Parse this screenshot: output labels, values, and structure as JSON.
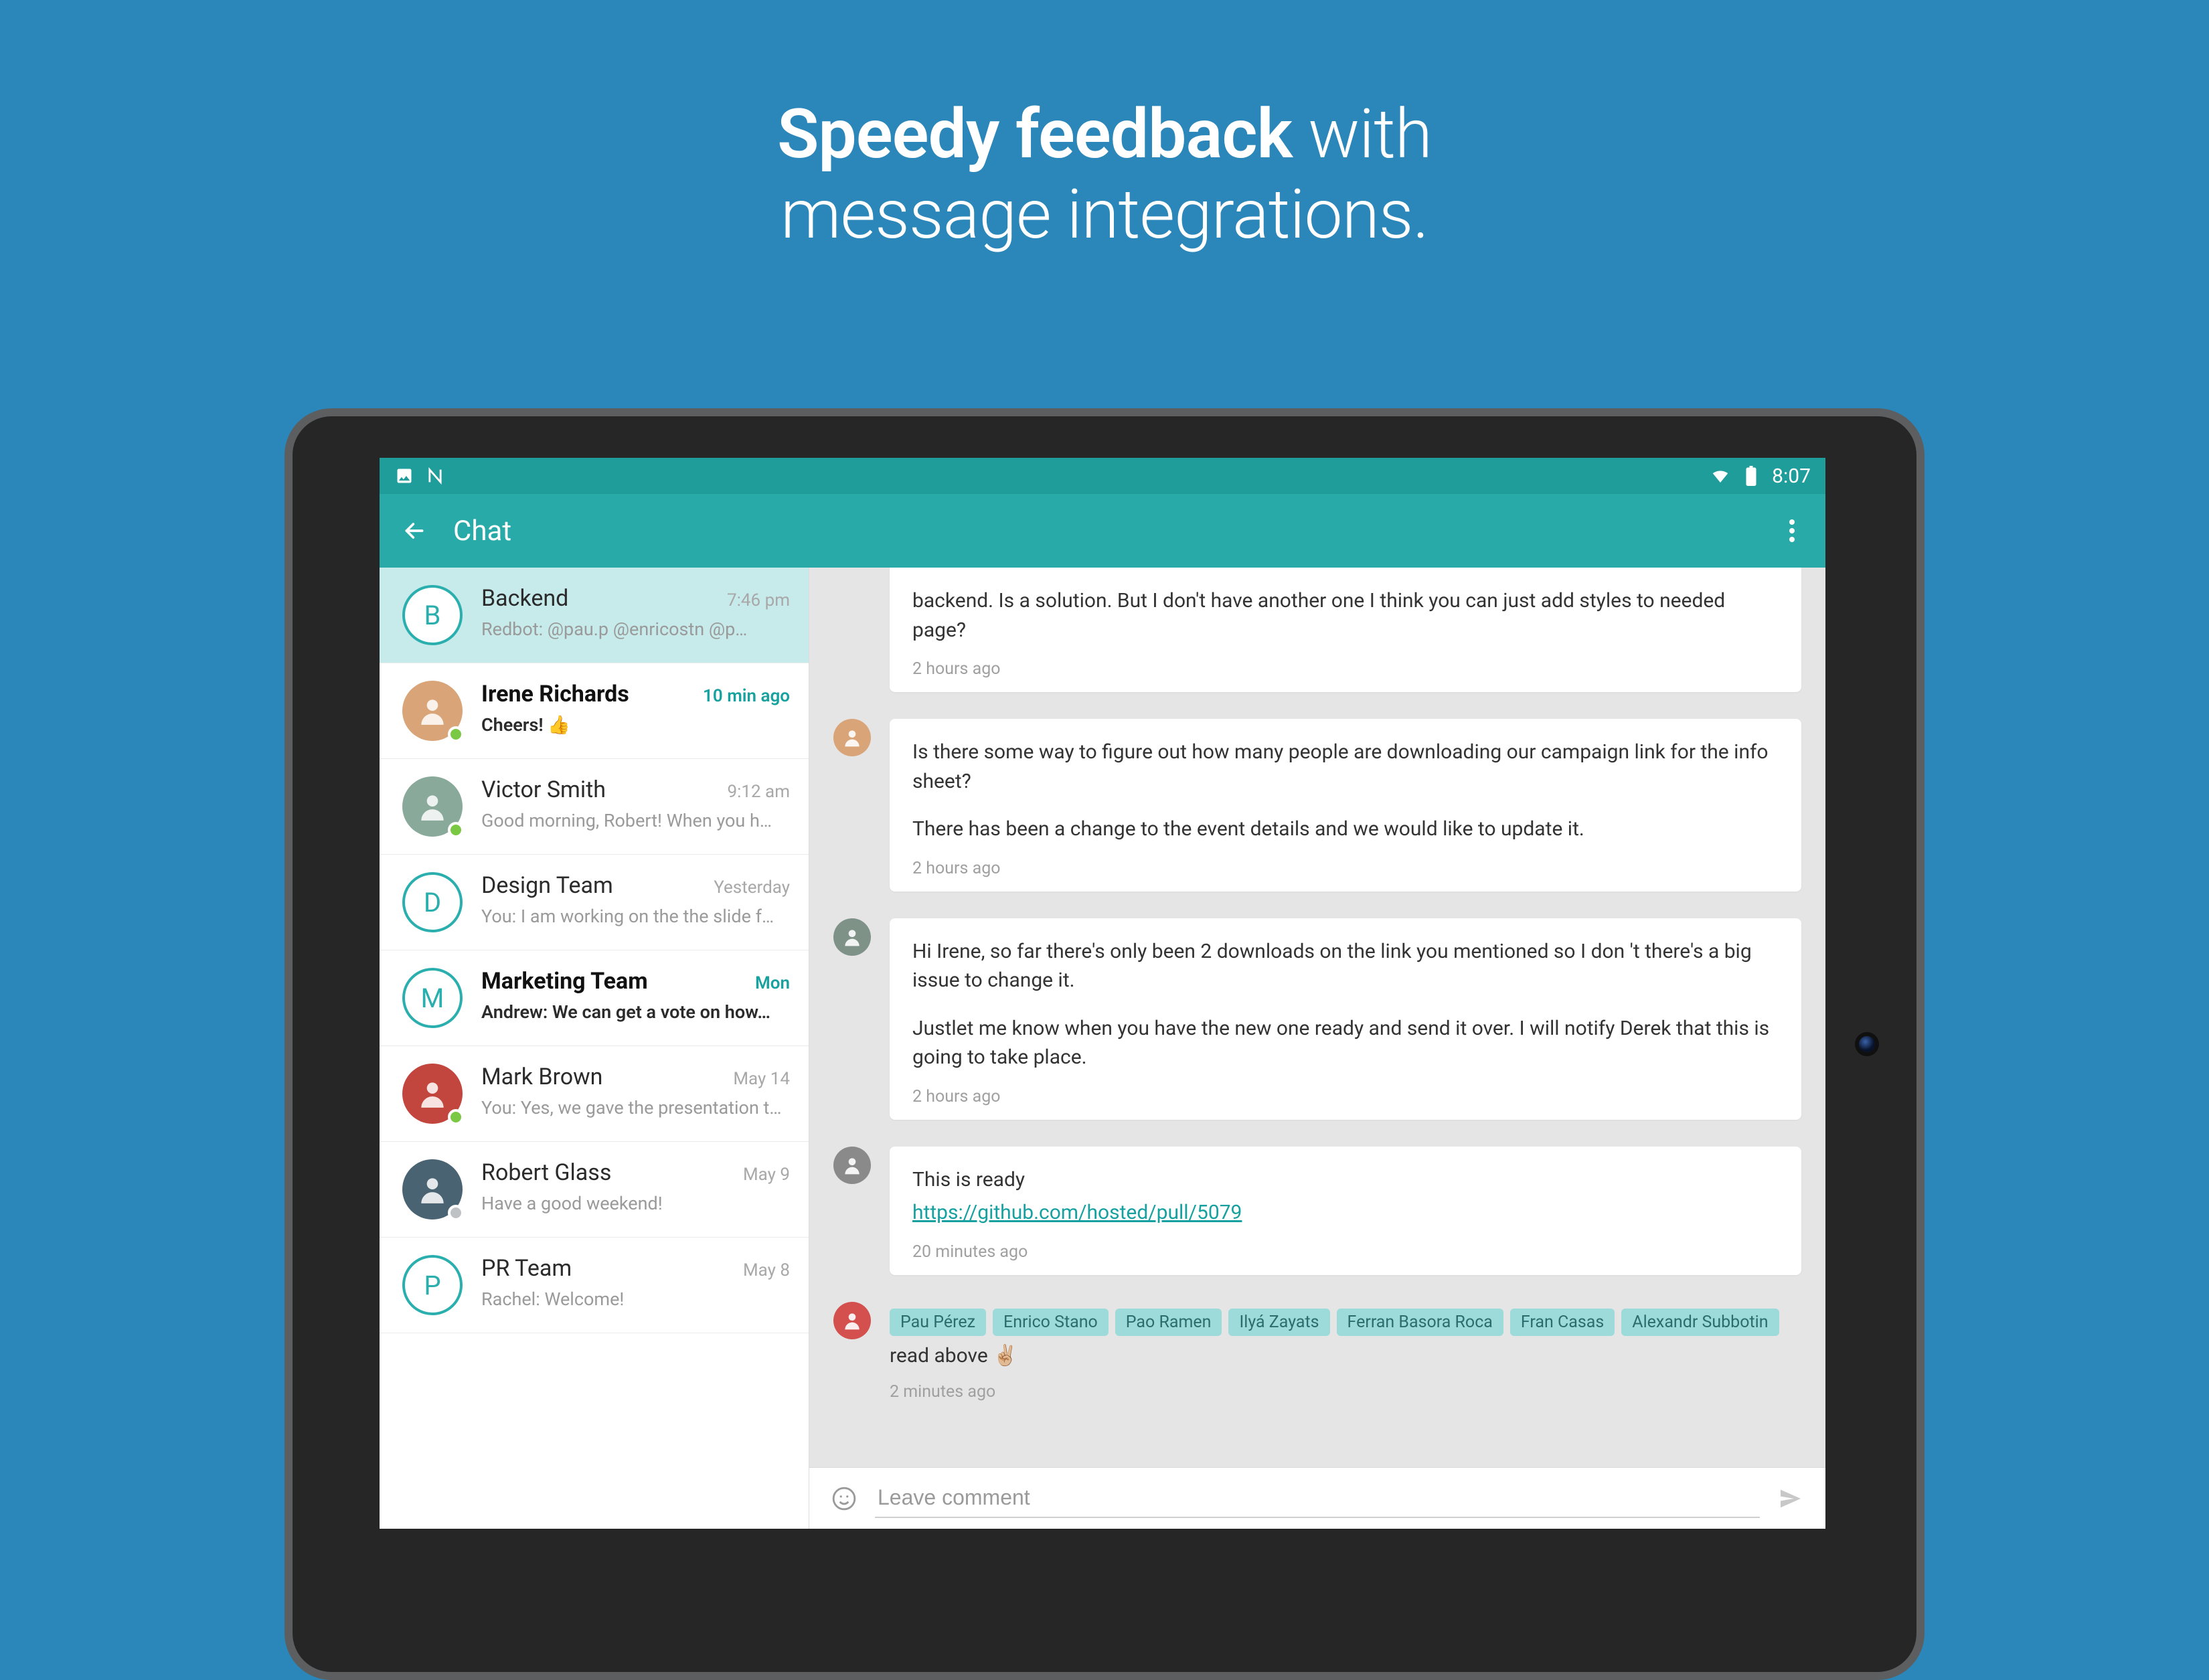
{
  "hero": {
    "bold": "Speedy feedback",
    "rest1": " with",
    "line2": "message integrations."
  },
  "statusbar": {
    "time": "8:07"
  },
  "appbar": {
    "title": "Chat"
  },
  "sidebar": {
    "items": [
      {
        "letter": "B",
        "name": "Backend",
        "time": "7:46 pm",
        "preview": "Redbot: @pau.p @enricostn @p…",
        "selected": true,
        "avatar_type": "letter"
      },
      {
        "name": "Irene Richards",
        "time": "10 min ago",
        "time_teal": true,
        "name_bold": true,
        "preview": "Cheers!  👍",
        "preview_strong": true,
        "avatar_type": "photo",
        "avatar_bg": "#d9a477",
        "presence": "online"
      },
      {
        "name": "Victor Smith",
        "time": "9:12 am",
        "preview": "Good morning, Robert!  When you h…",
        "avatar_type": "photo",
        "avatar_bg": "#89a99a",
        "presence": "online"
      },
      {
        "letter": "D",
        "name": "Design Team",
        "time": "Yesterday",
        "preview": "You: I am working on the the slide f…",
        "avatar_type": "letter"
      },
      {
        "letter": "M",
        "name": "Marketing Team",
        "time": "Mon",
        "time_teal": true,
        "name_bold": true,
        "preview": "Andrew: We can get a vote on how…",
        "preview_strong": true,
        "avatar_type": "letter"
      },
      {
        "name": "Mark Brown",
        "time": "May 14",
        "preview": "You: Yes, we gave the presentation t…",
        "avatar_type": "photo",
        "avatar_bg": "#c2453e",
        "presence": "online"
      },
      {
        "name": "Robert Glass",
        "time": "May 9",
        "preview": "Have a good weekend!",
        "avatar_type": "photo",
        "avatar_bg": "#4a6372",
        "presence": "away"
      },
      {
        "letter": "P",
        "name": "PR Team",
        "time": "May 8",
        "preview": "Rachel: Welcome!",
        "avatar_type": "letter"
      }
    ]
  },
  "thread": {
    "messages": [
      {
        "kind": "partial",
        "paragraphs": [
          "backend. Is a solution. But I don't have another one I think you can just add styles to needed page?"
        ],
        "meta": "2 hours ago"
      },
      {
        "kind": "normal",
        "avatar_bg": "#d9a477",
        "paragraphs": [
          "Is there some way to figure out how many people are downloading our campaign link for the info sheet?",
          "There has been a change to the event details and we would like to update it."
        ],
        "meta": "2 hours ago"
      },
      {
        "kind": "normal",
        "avatar_bg": "#7f9288",
        "paragraphs": [
          "Hi Irene, so far there's only been 2 downloads on the link you mentioned so I don 't there's a big issue to change it.",
          "Justlet me know when you have the new one ready and send it over. I will notify Derek that this is going to take place."
        ],
        "meta": "2 hours ago"
      },
      {
        "kind": "link",
        "avatar_bg": "#8a8a8a",
        "text": "This is ready",
        "link": "https://github.com/hosted/pull/5079",
        "meta": "20 minutes ago"
      },
      {
        "kind": "tags",
        "avatar_bg": "#d4504f",
        "tags": [
          "Pau Pérez",
          "Enrico Stano",
          "Pao Ramen",
          "Ilyá Zayats",
          "Ferran Basora Roca",
          "Fran Casas",
          "Alexandr Subbotin"
        ],
        "tagline_suffix": "read above ✌🏼",
        "meta": "2 minutes ago"
      }
    ]
  },
  "composer": {
    "placeholder": "Leave comment"
  }
}
